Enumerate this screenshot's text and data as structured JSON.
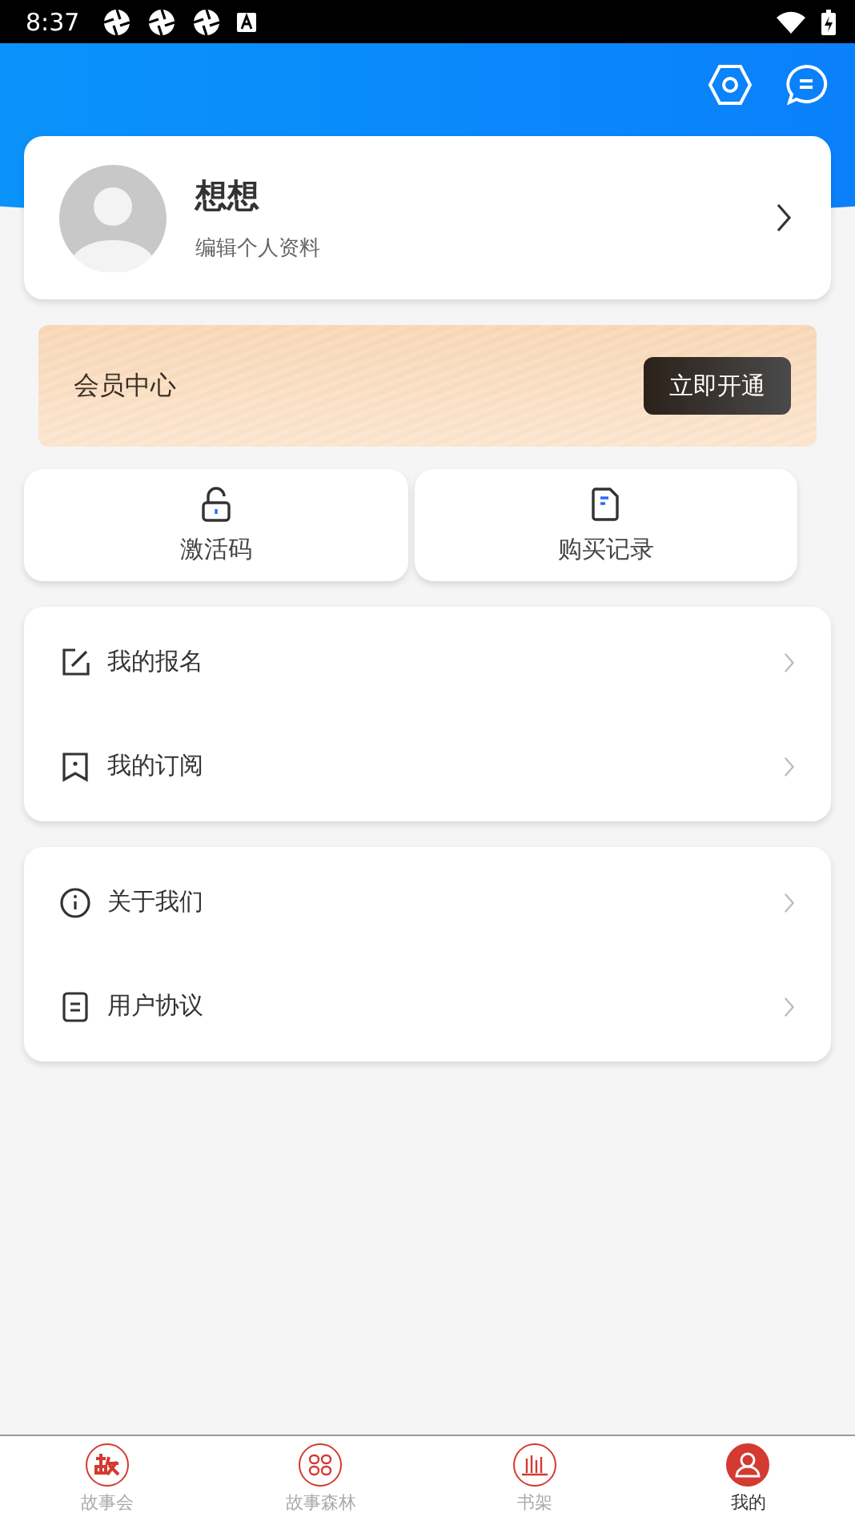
{
  "status_bar": {
    "time": "8:37"
  },
  "profile": {
    "name": "想想",
    "subtitle": "编辑个人资料"
  },
  "membership": {
    "title": "会员中心",
    "button": "立即开通"
  },
  "quick_actions": [
    {
      "kind": "lock",
      "label": "激活码"
    },
    {
      "kind": "receipt",
      "label": "购买记录"
    }
  ],
  "menu_groups": [
    [
      {
        "kind": "edit",
        "label": "我的报名"
      },
      {
        "kind": "bookmark",
        "label": "我的订阅"
      }
    ],
    [
      {
        "kind": "info",
        "label": "关于我们"
      },
      {
        "kind": "document",
        "label": "用户协议"
      }
    ]
  ],
  "bottom_nav": [
    {
      "kind": "story",
      "label": "故事会",
      "selected": false
    },
    {
      "kind": "grid",
      "label": "故事森林",
      "selected": false
    },
    {
      "kind": "shelf",
      "label": "书架",
      "selected": false
    },
    {
      "kind": "user",
      "label": "我的",
      "selected": true
    }
  ]
}
